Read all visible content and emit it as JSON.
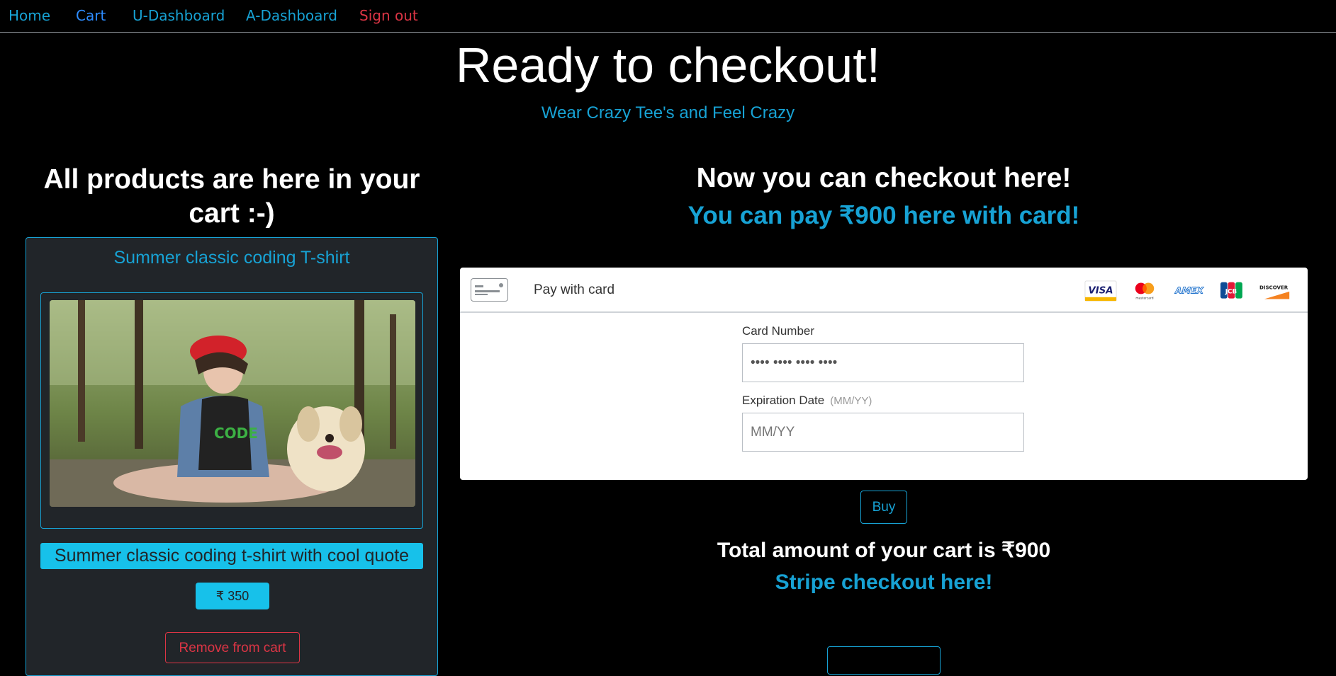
{
  "nav": {
    "home": "Home",
    "cart": "Cart",
    "user_dashboard": "U-Dashboard",
    "admin_dashboard": "A-Dashboard",
    "signout": "Sign out"
  },
  "hero": {
    "title": "Ready to checkout!",
    "subtitle": "Wear Crazy Tee's and Feel Crazy"
  },
  "cart": {
    "heading": "All products are here in your cart :-)",
    "product": {
      "title": "Summer classic coding T-shirt",
      "description": "Summer classic coding t-shirt with cool quote",
      "price": "₹ 350",
      "remove_label": "Remove from cart",
      "image_alt": "product-image"
    }
  },
  "checkout": {
    "heading": "Now you can checkout here!",
    "subheading": "You can pay ₹900 here with card!",
    "pay_with_card": "Pay with card",
    "brands": [
      "VISA",
      "mastercard",
      "AMEX",
      "JCB",
      "DISCOVER"
    ],
    "card_number_label": "Card Number",
    "card_number_placeholder": "•••• •••• •••• ••••",
    "expiry_label": "Expiration Date",
    "expiry_hint": "(MM/YY)",
    "expiry_placeholder": "MM/YY",
    "buy_label": "Buy",
    "total_text": "Total amount of your cart is ₹900",
    "stripe_text": "Stripe checkout here!"
  },
  "colors": {
    "accent": "#17a2d4",
    "danger": "#dc3545",
    "link": "#1e90ff",
    "card_bg": "#212529"
  }
}
